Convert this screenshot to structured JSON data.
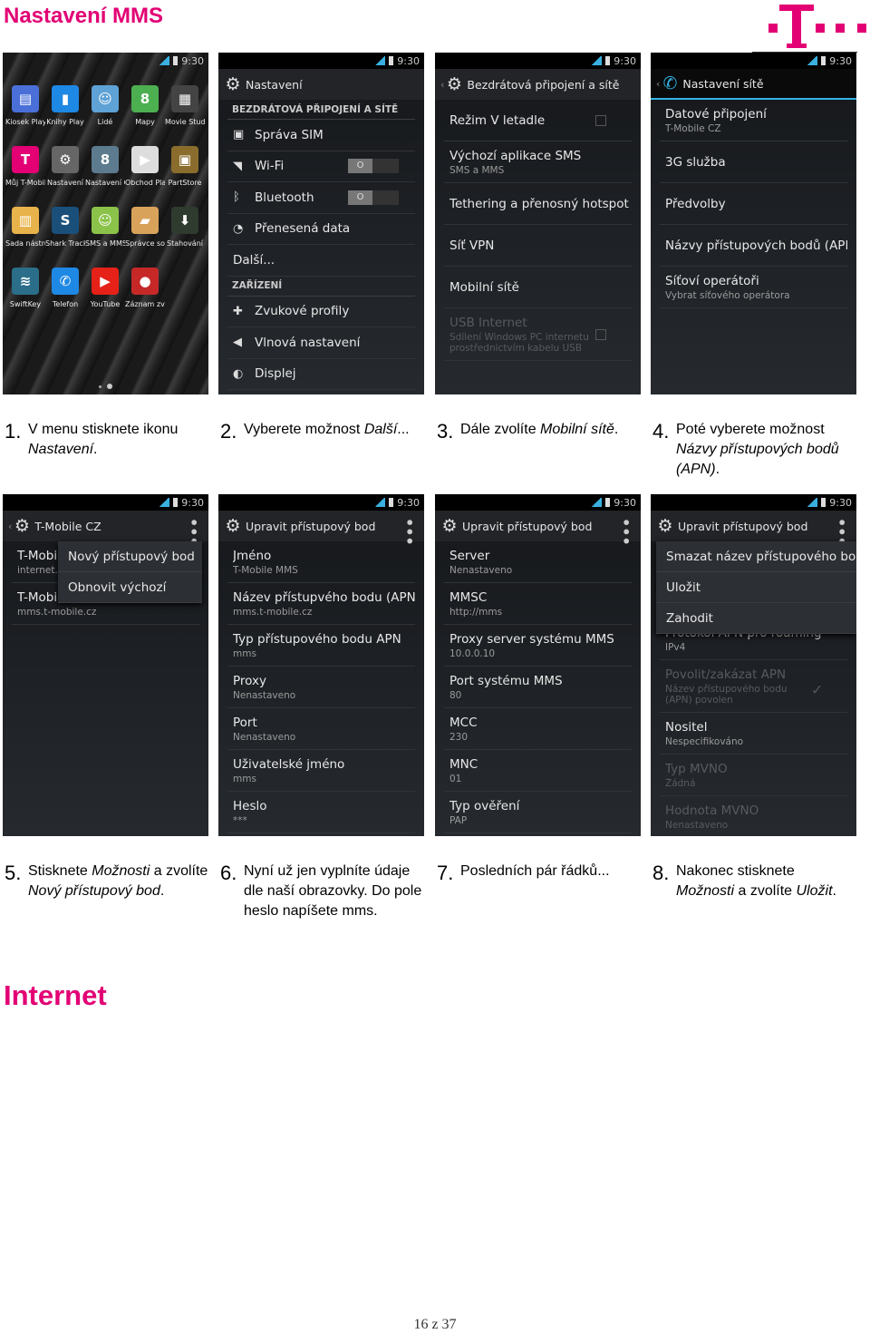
{
  "title": "Nastavení MMS",
  "logo": {
    "text": "T · ·",
    "color": "#e20074"
  },
  "section2_title": "Internet",
  "footer": "16 z 37",
  "status": {
    "time": "9:30"
  },
  "screens": [
    {
      "type": "home",
      "apps": [
        {
          "label": "Kiosek Play",
          "color": "#4a6fd8",
          "glyph": "▤"
        },
        {
          "label": "Knihy Play",
          "color": "#1e88e5",
          "glyph": "▮"
        },
        {
          "label": "Lidé",
          "color": "#5ea2d6",
          "glyph": "☺"
        },
        {
          "label": "Mapy",
          "color": "#4caf50",
          "glyph": "8"
        },
        {
          "label": "Movie Studio",
          "color": "#444",
          "glyph": "▦"
        },
        {
          "label": "Můj T-Mobile",
          "color": "#e20074",
          "glyph": "T"
        },
        {
          "label": "Nastavení",
          "color": "#666",
          "glyph": "⚙"
        },
        {
          "label": "Nastavení Google",
          "color": "#5d7b8f",
          "glyph": "8"
        },
        {
          "label": "Obchod Play",
          "color": "#ddd",
          "glyph": "▶"
        },
        {
          "label": "PartStore",
          "color": "#8a6d2d",
          "glyph": "▣"
        },
        {
          "label": "Sada nástrojů SIM",
          "color": "#e8b34a",
          "glyph": "▥"
        },
        {
          "label": "Shark Tracker",
          "color": "#1a4f7a",
          "glyph": "S"
        },
        {
          "label": "SMS a MMS",
          "color": "#8bc34a",
          "glyph": "☺"
        },
        {
          "label": "Správce souborů",
          "color": "#d9a25a",
          "glyph": "▰"
        },
        {
          "label": "Stahování",
          "color": "#2e3b2e",
          "glyph": "⬇"
        },
        {
          "label": "SwiftKey",
          "color": "#2b6e8a",
          "glyph": "≋"
        },
        {
          "label": "Telefon",
          "color": "#1e88e5",
          "glyph": "✆"
        },
        {
          "label": "YouTube",
          "color": "#e62117",
          "glyph": "▶"
        },
        {
          "label": "Záznam zvuku",
          "color": "#c62828",
          "glyph": "●"
        }
      ]
    },
    {
      "type": "list",
      "title": "Nastavení",
      "icon": "gear-icon",
      "back": false,
      "items": [
        {
          "header": "BEZDRÁTOVÁ PŘIPOJENÍ A SÍTĚ"
        },
        {
          "t": "Správa SIM",
          "icon": "sim-icon",
          "g": "▣"
        },
        {
          "t": "Wi-Fi",
          "icon": "wifi-icon",
          "g": "◥",
          "toggle": "O"
        },
        {
          "t": "Bluetooth",
          "icon": "bluetooth-icon",
          "g": "ᛒ",
          "toggle": "O"
        },
        {
          "t": "Přenesená data",
          "icon": "data-usage-icon",
          "g": "◔"
        },
        {
          "t": "Další..."
        },
        {
          "header": "ZAŘÍZENÍ"
        },
        {
          "t": "Zvukové profily",
          "icon": "sound-profiles-icon",
          "g": "✚"
        },
        {
          "t": "Vlnová nastavení",
          "icon": "audio-icon",
          "g": "◀"
        },
        {
          "t": "Displej",
          "icon": "display-icon",
          "g": "◐"
        }
      ]
    },
    {
      "type": "list",
      "title": "Bezdrátová připojení a sítě",
      "icon": "gear-icon",
      "back": true,
      "items": [
        {
          "t": "Režim V letadle",
          "checkbox": true
        },
        {
          "t": "Výchozí aplikace SMS",
          "s": "SMS a MMS"
        },
        {
          "t": "Tethering a přenosný hotspot"
        },
        {
          "t": "Síť VPN"
        },
        {
          "t": "Mobilní sítě"
        },
        {
          "t": "USB Internet",
          "s": "Sdílení Windows PC internetu",
          "s2": "prostřednictvím kabelu USB",
          "disabled": true,
          "checkbox": true
        }
      ]
    },
    {
      "type": "list",
      "title": "Nastavení sítě",
      "icon": "phone-icon",
      "back": true,
      "blue": true,
      "items": [
        {
          "t": "Datové připojení",
          "s": "T-Mobile CZ"
        },
        {
          "t": "3G služba"
        },
        {
          "t": "Předvolby"
        },
        {
          "t": "Názvy přístupových bodů (APN)"
        },
        {
          "t": "Síťoví operátoři",
          "s": "Vybrat síťového operátora"
        }
      ]
    },
    {
      "type": "list",
      "title": "T-Mobile CZ",
      "icon": "gear-icon",
      "back": true,
      "menu": true,
      "items": [
        {
          "t": "T-Mobile internet",
          "s": "internet.t-mobile.cz"
        },
        {
          "t": "T-Mobile MMS",
          "s": "mms.t-mobile.cz"
        }
      ],
      "popup": [
        "Nový přístupový bod",
        "Obnovit výchozí"
      ]
    },
    {
      "type": "list",
      "title": "Upravit přístupový bod",
      "icon": "gear-icon",
      "back": false,
      "menu": true,
      "items": [
        {
          "t": "Jméno",
          "s": "T-Mobile MMS"
        },
        {
          "t": "Název přístupvého bodu (APN)",
          "s": "mms.t-mobile.cz"
        },
        {
          "t": "Typ přístupového bodu APN",
          "s": "mms"
        },
        {
          "t": "Proxy",
          "s": "Nenastaveno"
        },
        {
          "t": "Port",
          "s": "Nenastaveno"
        },
        {
          "t": "Uživatelské jméno",
          "s": "mms"
        },
        {
          "t": "Heslo",
          "s": "***"
        }
      ]
    },
    {
      "type": "list",
      "title": "Upravit přístupový bod",
      "icon": "gear-icon",
      "back": false,
      "menu": true,
      "items": [
        {
          "t": "Server",
          "s": "Nenastaveno"
        },
        {
          "t": "MMSC",
          "s": "http://mms"
        },
        {
          "t": "Proxy server systému MMS",
          "s": "10.0.0.10"
        },
        {
          "t": "Port systému MMS",
          "s": "80"
        },
        {
          "t": "MCC",
          "s": "230"
        },
        {
          "t": "MNC",
          "s": "01"
        },
        {
          "t": "Typ ověření",
          "s": "PAP"
        }
      ]
    },
    {
      "type": "list",
      "title": "Upravit přístupový bod",
      "icon": "gear-icon",
      "back": false,
      "menu": true,
      "items": [
        {
          "t": "Protokol APN pro roaming",
          "s": "IPv4"
        },
        {
          "t": "Povolit/zakázat APN",
          "s": "Název přístupového bodu",
          "s2": "(APN) povolen",
          "disabled": true,
          "check": true
        },
        {
          "t": "Nositel",
          "s": "Nespecifikováno"
        },
        {
          "t": "Typ MVNO",
          "s": "Žádná",
          "disabled": true
        },
        {
          "t": "Hodnota MVNO",
          "s": "Nenastaveno",
          "disabled": true
        }
      ],
      "popup": [
        "Smazat název přístupového bodu",
        "Uložit",
        "Zahodit"
      ]
    }
  ],
  "captions": [
    {
      "n": "1.",
      "parts": [
        {
          "t": "V menu stisknete ikonu "
        },
        {
          "t": "Nastavení",
          "i": true
        },
        {
          "t": "."
        }
      ]
    },
    {
      "n": "2.",
      "parts": [
        {
          "t": "Vyberete možnost "
        },
        {
          "t": "Další",
          "i": true
        },
        {
          "t": "..."
        }
      ]
    },
    {
      "n": "3.",
      "parts": [
        {
          "t": "Dále zvolíte "
        },
        {
          "t": "Mobilní sítě",
          "i": true
        },
        {
          "t": "."
        }
      ]
    },
    {
      "n": "4.",
      "parts": [
        {
          "t": "Poté vyberete možnost "
        },
        {
          "t": "Názvy přístupových bodů (APN)",
          "i": true
        },
        {
          "t": "."
        }
      ]
    },
    {
      "n": "5.",
      "parts": [
        {
          "t": "Stisknete "
        },
        {
          "t": "Možnosti",
          "i": true
        },
        {
          "t": " a zvolíte "
        },
        {
          "t": "Nový přístupový bod",
          "i": true
        },
        {
          "t": "."
        }
      ]
    },
    {
      "n": "6.",
      "parts": [
        {
          "t": "Nyní už jen vyplníte údaje dle naší obrazovky. Do pole heslo napíšete mms."
        }
      ]
    },
    {
      "n": "7.",
      "parts": [
        {
          "t": "Posledních pár řádků..."
        }
      ]
    },
    {
      "n": "8.",
      "parts": [
        {
          "t": "Nakonec stisknete "
        },
        {
          "t": "Možnosti",
          "i": true
        },
        {
          "t": " a zvolíte "
        },
        {
          "t": "Uložit",
          "i": true
        },
        {
          "t": "."
        }
      ]
    }
  ]
}
